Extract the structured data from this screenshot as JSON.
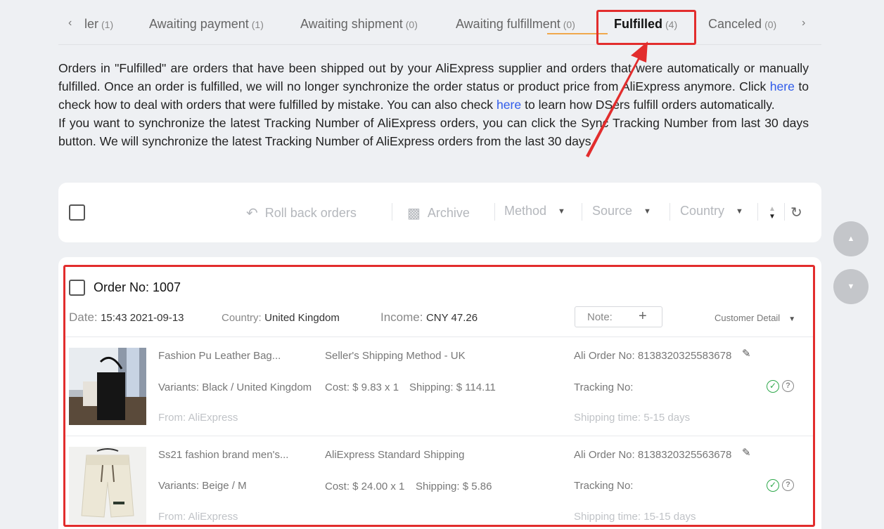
{
  "tabs": {
    "prev_icon": "chevron-left-icon",
    "next_icon": "chevron-right-icon",
    "items": [
      {
        "label": "ler",
        "count": "(1)"
      },
      {
        "label": "Awaiting payment",
        "count": "(1)"
      },
      {
        "label": "Awaiting shipment",
        "count": "(0)"
      },
      {
        "label": "Awaiting fulfillment",
        "count": "(0)"
      },
      {
        "label": "Fulfilled",
        "count": "(4)"
      },
      {
        "label": "Canceled",
        "count": "(0)"
      }
    ],
    "active_index": 4
  },
  "description": {
    "p1_a": "Orders in \"Fulfilled\" are orders that have been shipped out by your AliExpress supplier and orders that were automatically or manually fulfilled. Once an order is fulfilled, we will no longer synchronize the order status or product price from AliExpress anymore. Click ",
    "link1": "here",
    "p1_b": " to check how to deal with orders that were fulfilled by mistake. You can also check ",
    "link2": "here",
    "p1_c": " to learn how DSers fulfill orders automatically.",
    "p2": "If you want to synchronize the latest Tracking Number of AliExpress orders, you can click the Sync Tracking Number from last 30 days button. We will synchronize the latest Tracking Number of AliExpress orders from the last 30 days."
  },
  "toolbar": {
    "rollback_label": "Roll back orders",
    "archive_label": "Archive",
    "method_label": "Method",
    "source_label": "Source",
    "country_label": "Country"
  },
  "order": {
    "order_no": "Order No: 1007",
    "date_label": "Date:",
    "date_value": "15:43 2021-09-13",
    "country_label": "Country:",
    "country_value": "United Kingdom",
    "income_label": "Income:",
    "income_value": "CNY 47.26",
    "note_label": "Note:",
    "customer_detail": "Customer Detail",
    "items": [
      {
        "title": "Fashion Pu Leather Bag...",
        "variants": "Variants: Black / United Kingdom",
        "from": "From: AliExpress",
        "shipping_method": "Seller's Shipping Method - UK",
        "cost": "Cost: $ 9.83 x 1",
        "shipping": "Shipping: $ 114.11",
        "ali_order": "Ali Order No: 8138320325583678",
        "tracking": "Tracking No:",
        "shipping_time": "Shipping time: 5-15 days"
      },
      {
        "title": "Ss21 fashion brand men's...",
        "variants": "Variants: Beige / M",
        "from": "From: AliExpress",
        "shipping_method": "AliExpress Standard Shipping",
        "cost": "Cost: $ 24.00 x 1",
        "shipping": "Shipping: $ 5.86",
        "ali_order": "Ali Order No: 8138320325563678",
        "tracking": "Tracking No:",
        "shipping_time": "Shipping time: 15-15 days"
      }
    ]
  },
  "colors": {
    "highlight": "#e22d2d",
    "link": "#2f5bea",
    "success": "#2ea84b"
  }
}
